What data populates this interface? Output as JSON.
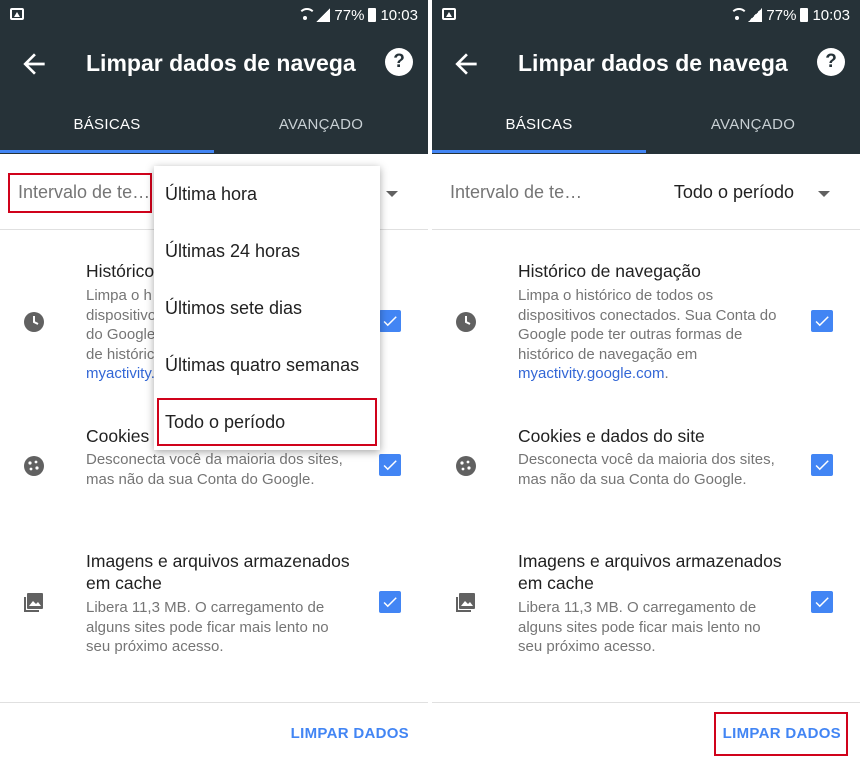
{
  "status_bar": {
    "battery": "77%",
    "time": "10:03"
  },
  "app_bar": {
    "title": "Limpar dados de navega…",
    "back_icon": "arrow-back-icon",
    "help_icon": "help-icon",
    "help_glyph": "?"
  },
  "tabs": {
    "basic": "BÁSICAS",
    "advanced": "AVANÇADO"
  },
  "left": {
    "range_label": "Intervalo de te…",
    "items": {
      "history_title": "Histórico",
      "history_desc_lines": [
        "Limpa o h",
        "dispositivo",
        "do Google",
        "de históric",
        "myactivity."
      ],
      "cookies_title": "Cookies",
      "cookies_desc": "Desconecta você da maioria dos sites, mas não da sua Conta do Google.",
      "cache_title": "Imagens e arquivos armazenados em cache",
      "cache_desc": "Libera 11,3 MB. O carregamento de alguns sites pode ficar mais lento no seu próximo acesso."
    },
    "clear_button": "LIMPAR DADOS"
  },
  "menu": {
    "options": [
      "Última hora",
      "Últimas 24 horas",
      "Últimos sete dias",
      "Últimas quatro semanas",
      "Todo o período"
    ],
    "highlighted": "Todo o período"
  },
  "right": {
    "range_label": "Intervalo de te…",
    "range_value": "Todo o período",
    "items": {
      "history_title": "Histórico de navegação",
      "history_desc": "Limpa o histórico de todos os dispositivos conectados. Sua Conta do Google pode ter outras formas de histórico de navegação em",
      "history_link": "myactivity.google.com",
      "history_suffix": ".",
      "cookies_title": "Cookies e dados do site",
      "cookies_desc": "Desconecta você da maioria dos sites, mas não da sua Conta do Google.",
      "cache_title": "Imagens e arquivos armazenados em cache",
      "cache_desc": "Libera 11,3 MB. O carregamento de alguns sites pode ficar mais lento no seu próximo acesso."
    },
    "clear_button": "LIMPAR DADOS"
  },
  "colors": {
    "app_bar": "#263238",
    "accent": "#4285f4",
    "link": "#3367d6",
    "highlight_box": "#d0021b"
  }
}
